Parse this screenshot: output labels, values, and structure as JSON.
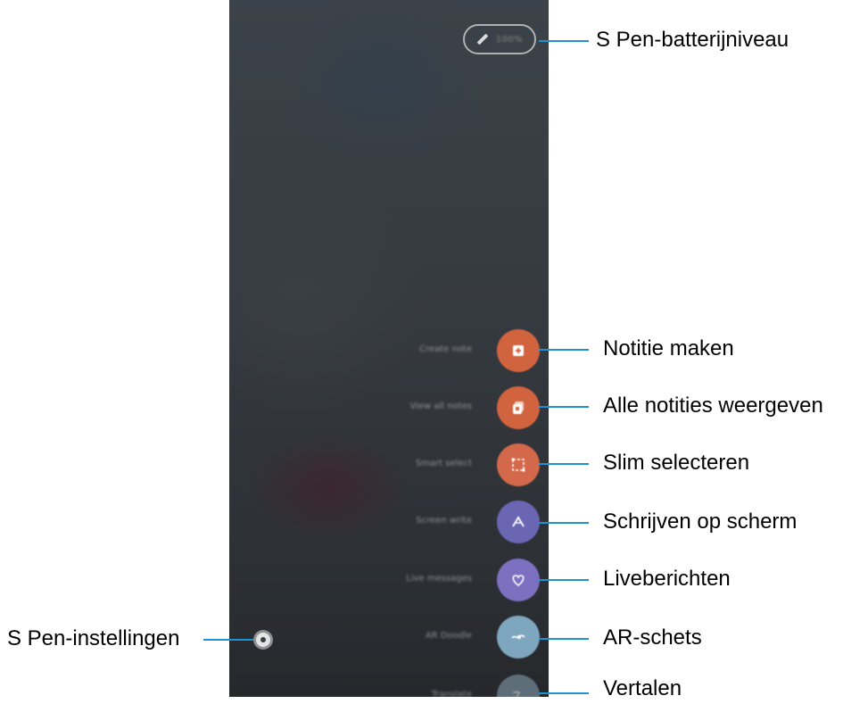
{
  "screen": {
    "battery": {
      "icon": "pen-icon",
      "text": "100%"
    },
    "menu_items": [
      {
        "label": "Create note",
        "icon": "note-add-icon",
        "color": "#d2633f"
      },
      {
        "label": "View all notes",
        "icon": "notes-icon",
        "color": "#d2633f"
      },
      {
        "label": "Smart select",
        "icon": "smart-select-icon",
        "color": "#d4684a"
      },
      {
        "label": "Screen write",
        "icon": "screen-write-icon",
        "color": "#6a66b4"
      },
      {
        "label": "Live messages",
        "icon": "live-message-icon",
        "color": "#7e70c0"
      },
      {
        "label": "AR Doodle",
        "icon": "ar-doodle-icon",
        "color": "#7ea7bf"
      },
      {
        "label": "Translate",
        "icon": "translate-icon",
        "color": "#8ba7b8"
      }
    ],
    "settings_icon": "gear-icon"
  },
  "callouts": {
    "battery": "S Pen-batterijniveau",
    "items": [
      "Notitie maken",
      "Alle notities weergeven",
      "Slim selecteren",
      "Schrijven op scherm",
      "Liveberichten",
      "AR-schets",
      "Vertalen"
    ],
    "settings": "S Pen-instellingen"
  },
  "colors": {
    "leader_line": "#1f93d1",
    "screen_bg": "#363b41"
  }
}
